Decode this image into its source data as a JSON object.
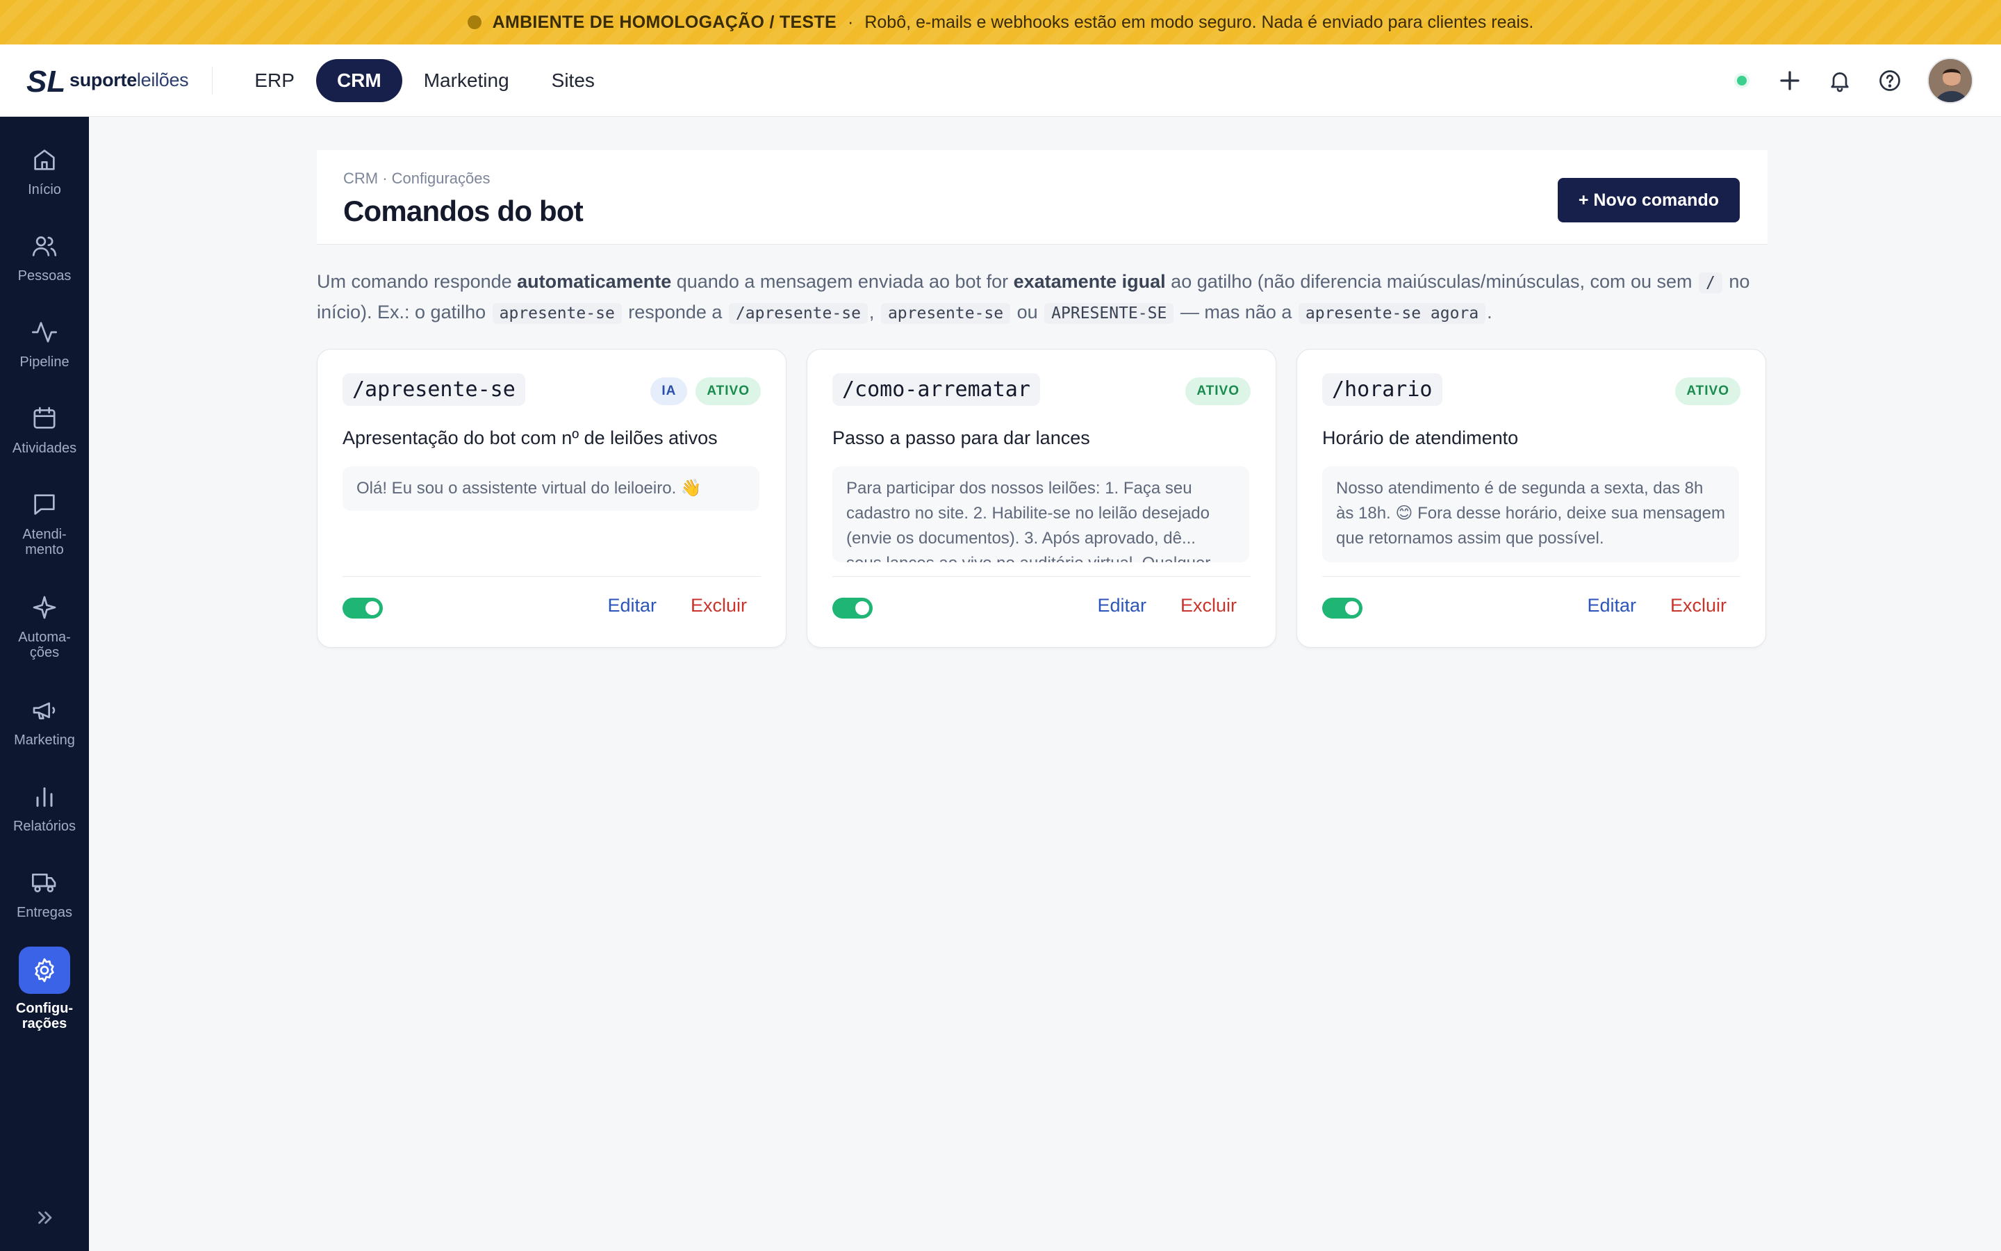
{
  "banner": {
    "title": "AMBIENTE DE HOMOLOGAÇÃO / TESTE",
    "separator": "·",
    "message": "Robô, e-mails e webhooks estão em modo seguro. Nada é enviado para clientes reais."
  },
  "brand": {
    "logo_mark": "SL",
    "name_bold": "suporte",
    "name_light": "leilões"
  },
  "modules": [
    {
      "label": "ERP",
      "active": false
    },
    {
      "label": "CRM",
      "active": true
    },
    {
      "label": "Marketing",
      "active": false
    },
    {
      "label": "Sites",
      "active": false
    }
  ],
  "topbar_icons": [
    "plus-icon",
    "bell-icon",
    "help-icon"
  ],
  "sidebar": {
    "items": [
      {
        "label": "Início",
        "icon": "home-icon"
      },
      {
        "label": "Pessoas",
        "icon": "people-icon"
      },
      {
        "label": "Pipeline",
        "icon": "activity-icon"
      },
      {
        "label": "Atividades",
        "icon": "calendar-icon"
      },
      {
        "label": "Atendi-\nmento",
        "icon": "chat-icon"
      },
      {
        "label": "Automa-\nções",
        "icon": "sparkle-icon"
      },
      {
        "label": "Marketing",
        "icon": "megaphone-icon"
      },
      {
        "label": "Relatórios",
        "icon": "bar-chart-icon"
      },
      {
        "label": "Entregas",
        "icon": "truck-icon"
      },
      {
        "label": "Configu-\nrações",
        "icon": "gear-icon",
        "active": true
      }
    ]
  },
  "page": {
    "breadcrumb": "CRM · Configurações",
    "title": "Comandos do bot",
    "new_button": "+ Novo comando"
  },
  "description": {
    "p1": "Um comando responde ",
    "b1": "automaticamente",
    "p2": " quando a mensagem enviada ao bot for ",
    "b2": "exatamente igual",
    "p3": " ao gatilho (não diferencia maiúsculas/minúsculas, com ou sem ",
    "c0": "/",
    "p4": " no início). Ex.: o gatilho ",
    "c1": "apresente-se",
    "p5": " responde a ",
    "c2": "/apresente-se",
    "p6": ", ",
    "c3": "apresente-se",
    "p7": " ou ",
    "c4": "APRESENTE-SE",
    "p8": " — mas não a ",
    "c5": "apresente-se agora",
    "p9": "."
  },
  "commands": [
    {
      "trigger": "/apresente-se",
      "badges": [
        "IA",
        "ATIVO"
      ],
      "title": "Apresentação do bot com nº de leilões ativos",
      "preview": "Olá! Eu sou o assistente virtual do leiloeiro. 👋",
      "enabled": true,
      "edit_label": "Editar",
      "delete_label": "Excluir"
    },
    {
      "trigger": "/como-arrematar",
      "badges": [
        "ATIVO"
      ],
      "title": "Passo a passo para dar lances",
      "preview": "Para participar dos nossos leilões: 1. Faça seu cadastro no site. 2. Habilite-se no leilão desejado (envie os documentos). 3. Após aprovado, dê... seus lances ao vivo no auditório virtual. Qualquer",
      "enabled": true,
      "edit_label": "Editar",
      "delete_label": "Excluir"
    },
    {
      "trigger": "/horario",
      "badges": [
        "ATIVO"
      ],
      "title": "Horário de atendimento",
      "preview": "Nosso atendimento é de segunda a sexta, das 8h às 18h. 😊 Fora desse horário, deixe sua mensagem que retornamos assim que possível.",
      "enabled": true,
      "edit_label": "Editar",
      "delete_label": "Excluir"
    }
  ],
  "colors": {
    "banner": "#f2bb2b",
    "navy": "#16204a",
    "sidebar": "#0e1730",
    "sidebar_active": "#3a63e8",
    "toggle_on": "#1fb574",
    "edit": "#2b55b8",
    "delete": "#c8332b",
    "status_ok": "#3ccf8e"
  }
}
